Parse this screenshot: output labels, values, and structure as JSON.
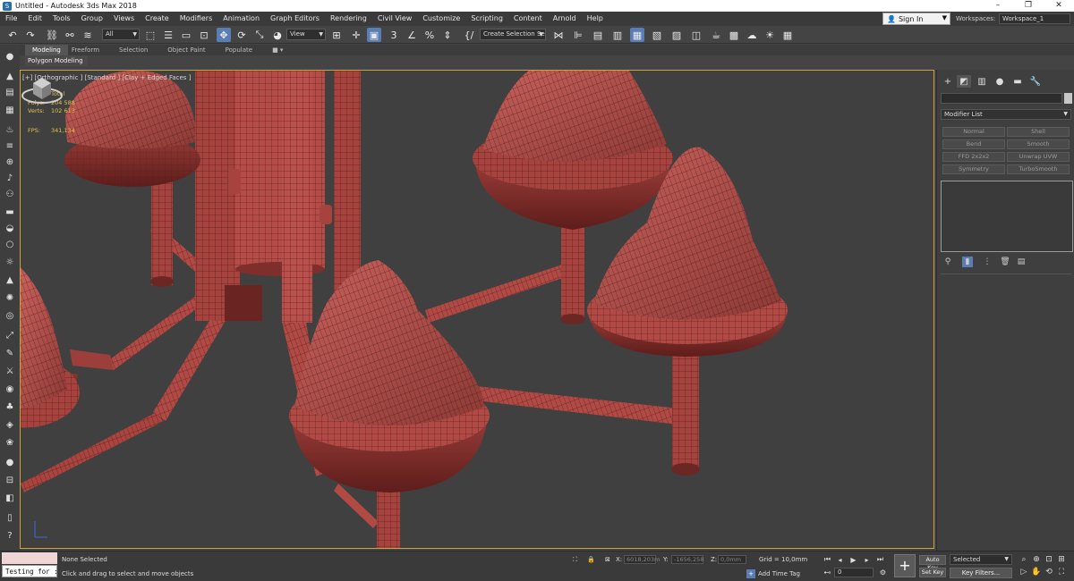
{
  "window": {
    "title": "Untitled - Autodesk 3ds Max 2018",
    "app_icon": "3ds-max-icon",
    "controls": [
      "–",
      "❐",
      "✕"
    ]
  },
  "menu": [
    "File",
    "Edit",
    "Tools",
    "Group",
    "Views",
    "Create",
    "Modifiers",
    "Animation",
    "Graph Editors",
    "Rendering",
    "Civil View",
    "Customize",
    "Scripting",
    "Content",
    "Arnold",
    "Help"
  ],
  "account": {
    "signin_label": "Sign In",
    "workspaces_label": "Workspaces:",
    "workspace_value": "Workspace_1"
  },
  "toolbar": {
    "filter_value": "All",
    "refcoord_value": "View",
    "selection_set_value": "Create Selection Se",
    "snap_label": "3",
    "angle_snap_label": "∠",
    "percent_snap_label": "%"
  },
  "ribbon": {
    "tabs": [
      "Modeling",
      "Freeform",
      "Selection",
      "Object Paint",
      "Populate"
    ],
    "sub_label": "Polygon Modeling"
  },
  "viewport": {
    "label": "[+] [Orthographic ] [Standard ] [Clay + Edged Faces ]",
    "stats": {
      "total_label": "Total",
      "polys_label": "Polys:",
      "polys_value": "204 588",
      "verts_label": "Verts:",
      "verts_value": "102 613",
      "fps_label": "FPS:",
      "fps_value": "341,134"
    },
    "colors": {
      "object": "#b9504c",
      "object_dark": "#7e2f2c",
      "wire": "#3a1210",
      "background": "#404040",
      "border": "#c9a437"
    }
  },
  "command_panel": {
    "modifier_list_label": "Modifier List",
    "modifier_buttons": [
      "Normal",
      "Shell",
      "Bend",
      "Smooth",
      "FFD 2x2x2",
      "Unwrap UVW",
      "Symmetry",
      "TurboSmooth"
    ]
  },
  "status": {
    "listener_text": "Testing for :",
    "selection_text": "None Selected",
    "prompt_text": "Click and drag to select and move objects",
    "x_label": "X:",
    "x_value": "6018,203m",
    "y_label": "Y:",
    "y_value": "-1656,258",
    "z_label": "Z:",
    "z_value": "0,0mm",
    "grid_text": "Grid = 10,0mm",
    "add_time_tag": "Add Time Tag",
    "frame_value": "0",
    "auto_key": "Auto Key",
    "set_key": "Set Key",
    "selected_value": "Selected",
    "key_filters": "Key Filters..."
  }
}
